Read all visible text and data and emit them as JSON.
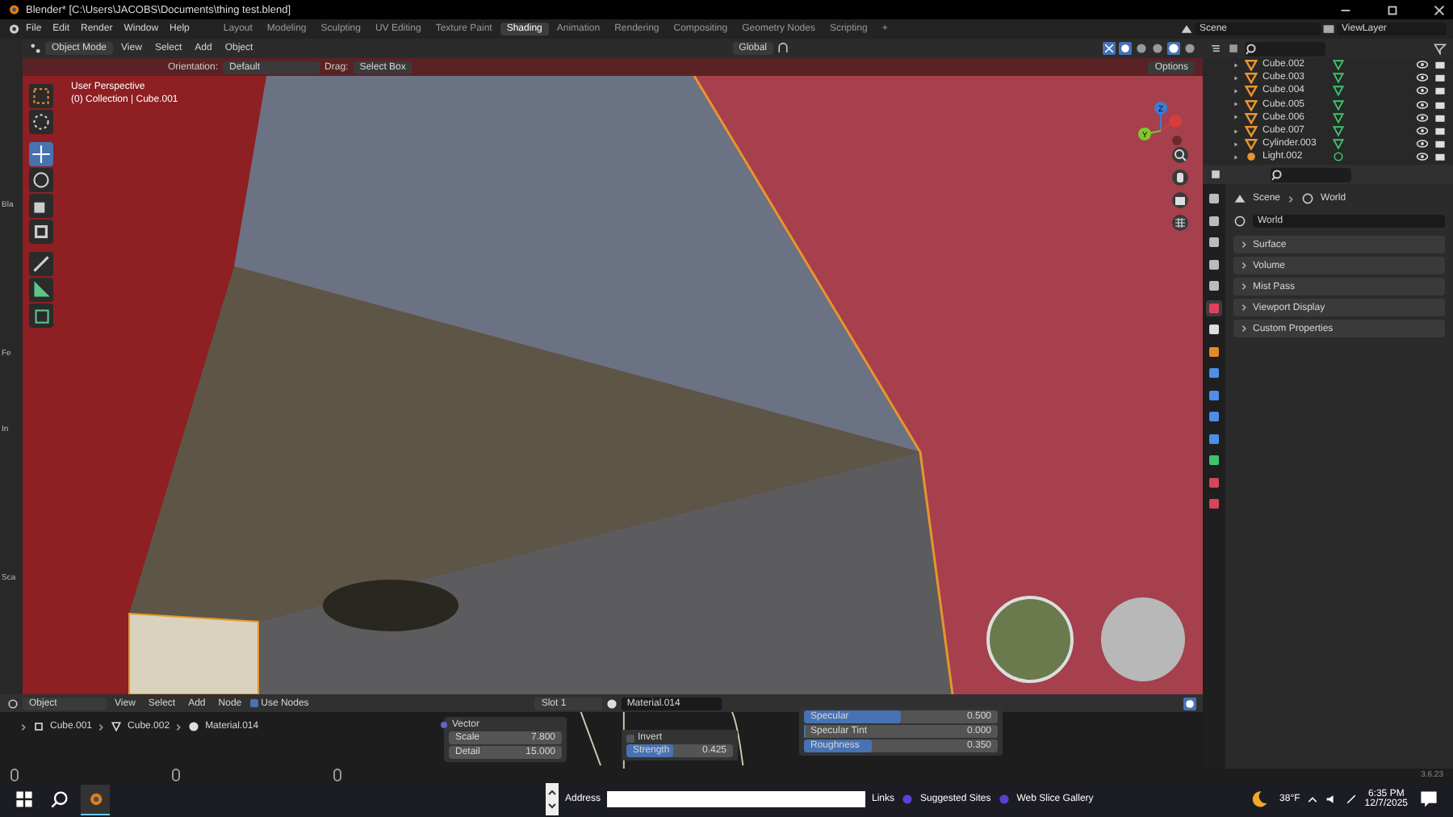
{
  "title_bar": {
    "title": "Blender* [C:\\Users\\JACOBS\\Documents\\thing test.blend]"
  },
  "menu": [
    "File",
    "Edit",
    "Render",
    "Window",
    "Help"
  ],
  "workspaces": [
    {
      "label": "Layout",
      "selected": false
    },
    {
      "label": "Modeling",
      "selected": false
    },
    {
      "label": "Sculpting",
      "selected": false
    },
    {
      "label": "UV Editing",
      "selected": false
    },
    {
      "label": "Texture Paint",
      "selected": false
    },
    {
      "label": "Shading",
      "selected": true
    },
    {
      "label": "Animation",
      "selected": false
    },
    {
      "label": "Rendering",
      "selected": false
    },
    {
      "label": "Compositing",
      "selected": false
    },
    {
      "label": "Geometry Nodes",
      "selected": false
    },
    {
      "label": "Scripting",
      "selected": false
    }
  ],
  "workspace_add": "+",
  "scene": "Scene",
  "view_layer": "ViewLayer",
  "left_strip": {
    "labels": [
      "Bla",
      "Fe",
      "In",
      "Sca"
    ]
  },
  "viewport": {
    "mode": "Object Mode",
    "menus": [
      "View",
      "Select",
      "Add",
      "Object"
    ],
    "transform": "Global",
    "shading_modes": [
      {
        "selected": false
      },
      {
        "selected": false
      },
      {
        "selected": true
      },
      {
        "selected": false
      }
    ],
    "orientation_label": "Orientation:",
    "orientation": "Default",
    "drag_label": "Drag:",
    "drag": "Select Box",
    "options": "Options",
    "overlay_text": [
      "User Perspective",
      "(0) Collection | Cube.001"
    ],
    "tools": [
      {
        "kind": "select",
        "selected": false
      },
      {
        "kind": "cursor",
        "selected": false
      },
      {
        "kind": "move",
        "selected": true
      },
      {
        "kind": "rotate",
        "selected": false
      },
      {
        "kind": "scale",
        "selected": false
      },
      {
        "kind": "transform",
        "selected": false
      },
      {
        "kind": "annotate",
        "selected": false
      },
      {
        "kind": "measure",
        "selected": false
      },
      {
        "kind": "add_cube",
        "selected": false
      }
    ],
    "gizmo": [
      "Z",
      "Y"
    ]
  },
  "outliner": {
    "rows": [
      {
        "name": "Cube.002",
        "kind": "mesh"
      },
      {
        "name": "Cube.003",
        "kind": "mesh"
      },
      {
        "name": "Cube.004",
        "kind": "mesh"
      },
      {
        "name": "Cube.005",
        "kind": "mesh"
      },
      {
        "name": "Cube.006",
        "kind": "mesh"
      },
      {
        "name": "Cube.007",
        "kind": "mesh"
      },
      {
        "name": "Cylinder.003",
        "kind": "mesh"
      },
      {
        "name": "Light.002",
        "kind": "light"
      }
    ]
  },
  "properties": {
    "tabs": [
      {
        "kind": "tool",
        "selected": false
      },
      {
        "kind": "render",
        "selected": false
      },
      {
        "kind": "output",
        "selected": false
      },
      {
        "kind": "view_layer",
        "selected": false
      },
      {
        "kind": "scene",
        "selected": false
      },
      {
        "kind": "world",
        "selected": true
      },
      {
        "kind": "collection",
        "selected": false
      },
      {
        "kind": "object",
        "selected": false
      },
      {
        "kind": "modifier",
        "selected": false
      },
      {
        "kind": "particles",
        "selected": false
      },
      {
        "kind": "physics",
        "selected": false
      },
      {
        "kind": "constraints",
        "selected": false
      },
      {
        "kind": "data",
        "selected": false
      },
      {
        "kind": "material",
        "selected": false
      },
      {
        "kind": "texture",
        "selected": false
      }
    ],
    "breadcrumb": [
      "Scene",
      "World"
    ],
    "world": "World",
    "panels": [
      {
        "label": "Surface",
        "expanded": false
      },
      {
        "label": "Volume",
        "expanded": false
      },
      {
        "label": "Mist Pass",
        "expanded": false
      },
      {
        "label": "Viewport Display",
        "expanded": false
      },
      {
        "label": "Custom Properties",
        "expanded": false
      }
    ]
  },
  "node_editor": {
    "type": "Object",
    "menus": [
      "View",
      "Select",
      "Add",
      "Node"
    ],
    "use_nodes": {
      "label": "Use Nodes",
      "checked": true
    },
    "slot": "Slot 1",
    "material": "Material.014",
    "breadcrumb": [
      {
        "kind": "object",
        "label": "Cube.001"
      },
      {
        "kind": "mesh",
        "label": "Cube.002"
      },
      {
        "kind": "material",
        "label": "Material.014"
      }
    ],
    "texture_node": {
      "socket": "Vector",
      "fields": [
        {
          "label": "Scale",
          "value": "7.800"
        },
        {
          "label": "Detail",
          "value": "15.000"
        }
      ]
    },
    "bump_node": {
      "invert": {
        "label": "Invert",
        "checked": false
      },
      "slider": {
        "label": "Strength",
        "value": "0.425",
        "level": 0.425
      }
    },
    "shader_node": {
      "sliders": [
        {
          "label": "Specular",
          "value": "0.500",
          "level": 0.5
        },
        {
          "label": "Specular Tint",
          "value": "0.000",
          "level": 0
        },
        {
          "label": "Roughness",
          "value": "0.350",
          "level": 0.35
        }
      ]
    }
  },
  "version": "3.6.23",
  "taskbar": {
    "address_label": "Address",
    "links_label": "Links",
    "links": [
      "Suggested Sites",
      "Web Slice Gallery"
    ],
    "weather": "38°F",
    "time": "6:35 PM",
    "date": "12/7/2025"
  }
}
